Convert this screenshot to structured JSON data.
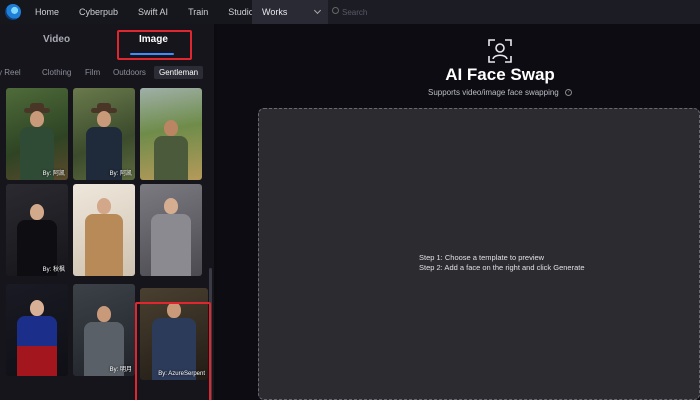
{
  "nav": {
    "items": [
      "Home",
      "Cyberpub",
      "Swift AI",
      "Train",
      "Studio"
    ],
    "works_label": "Works",
    "search_placeholder": "Search"
  },
  "left_panel": {
    "tabs": [
      {
        "label": "Video",
        "active": false
      },
      {
        "label": "Image",
        "active": true
      }
    ],
    "categories": [
      "y Reel",
      "Clothing",
      "Film",
      "Outdoors",
      "Gentleman"
    ],
    "active_category": "Gentleman",
    "cards": [
      {
        "byline": "By: 阿凯"
      },
      {
        "byline": "By: 阿凯"
      },
      {
        "byline": ""
      },
      {
        "byline": "By: 秋枫"
      },
      {
        "byline": ""
      },
      {
        "byline": ""
      },
      {
        "byline": ""
      },
      {
        "byline": "By: 明月"
      },
      {
        "byline": "By: AzureSerpent"
      }
    ]
  },
  "main": {
    "title": "AI Face Swap",
    "subtitle": "Supports video/image face swapping",
    "step1": "Step 1: Choose a template to preview",
    "step2": "Step 2: Add a face on the right and click Generate"
  },
  "colors": {
    "accent": "#3f8cff",
    "highlight": "#e0262f",
    "panel_bg": "#15151b",
    "dropzone_bg": "#2b2b30"
  },
  "icons": [
    "app-logo-icon",
    "chevron-down-icon",
    "search-icon",
    "face-scan-icon",
    "info-icon"
  ]
}
